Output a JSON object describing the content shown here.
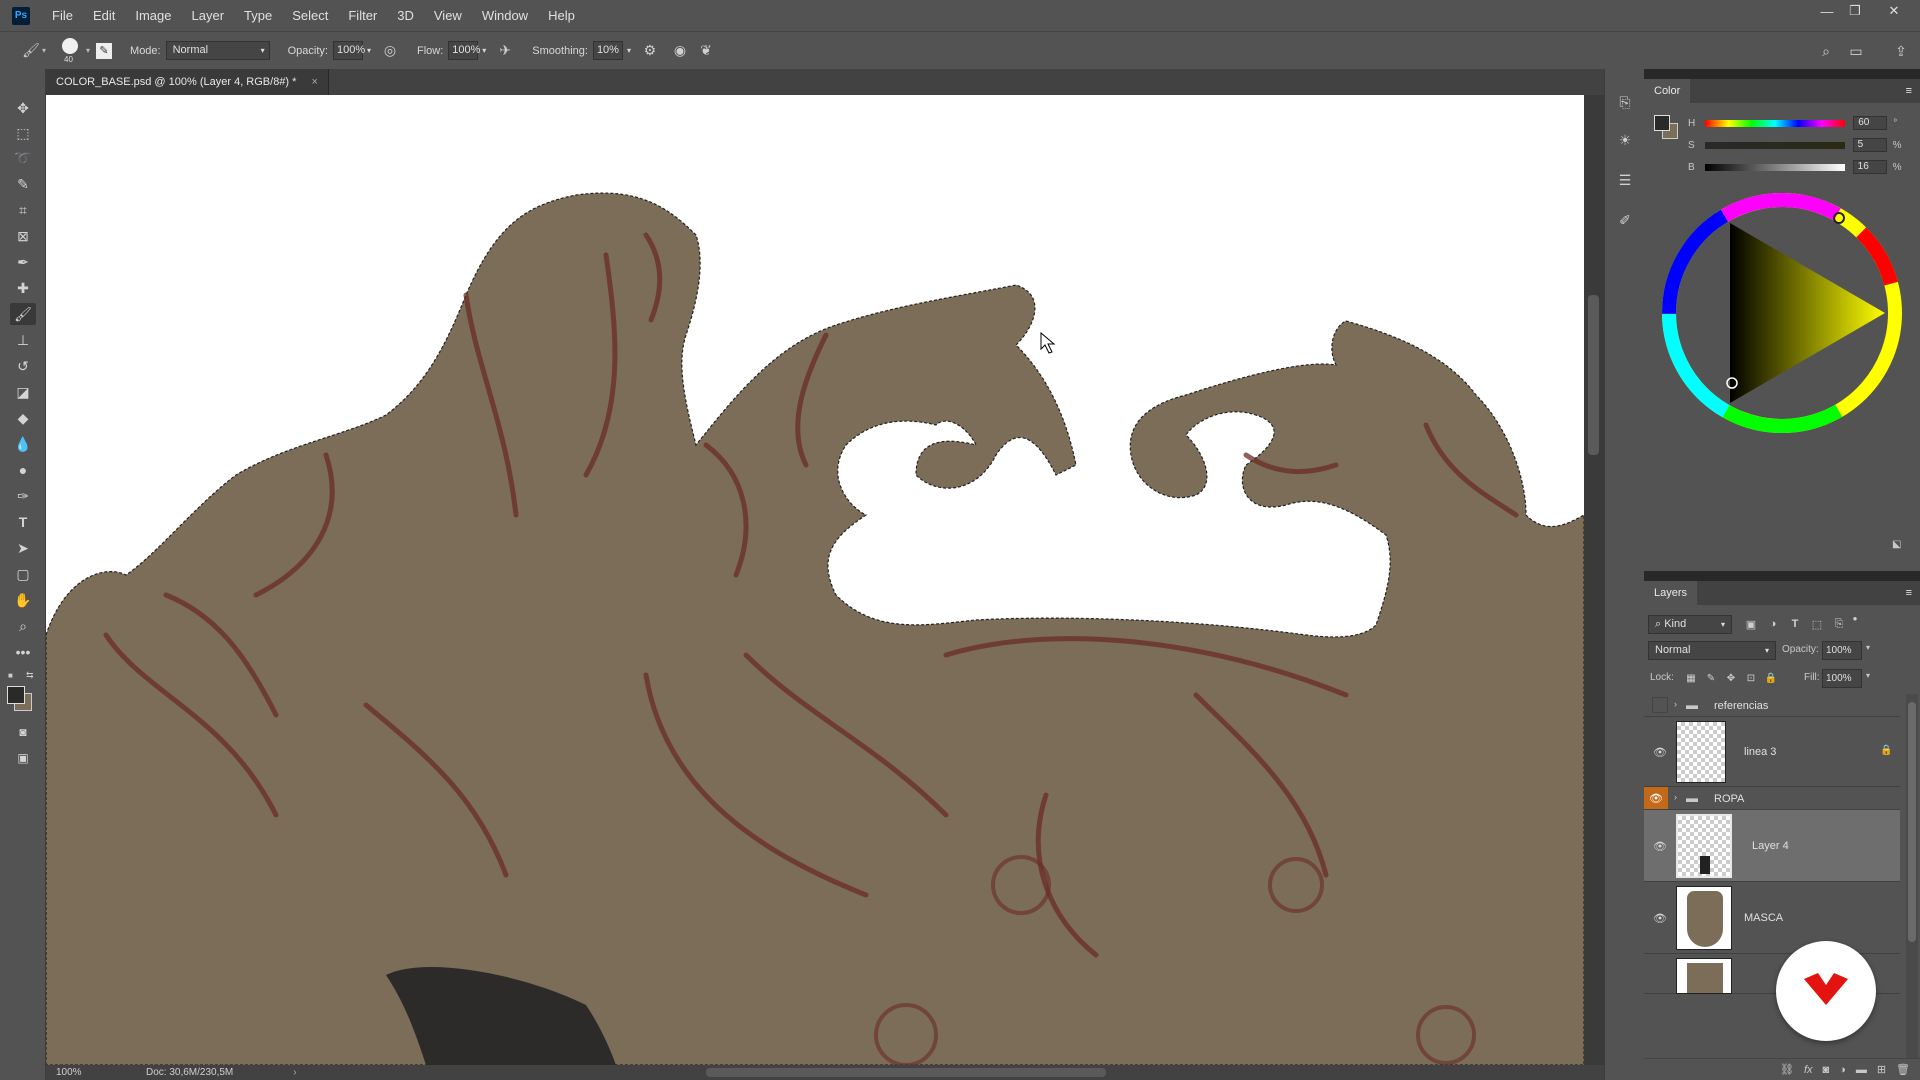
{
  "app": {
    "logo": "Ps"
  },
  "menu": [
    "File",
    "Edit",
    "Image",
    "Layer",
    "Type",
    "Select",
    "Filter",
    "3D",
    "View",
    "Window",
    "Help"
  ],
  "options": {
    "brush_size": "40",
    "mode_label": "Mode:",
    "mode_value": "Normal",
    "opacity_label": "Opacity:",
    "opacity_value": "100%",
    "flow_label": "Flow:",
    "flow_value": "100%",
    "smoothing_label": "Smoothing:",
    "smoothing_value": "10%"
  },
  "document": {
    "tab_title": "COLOR_BASE.psd @ 100% (Layer 4, RGB/8#) *",
    "close_glyph": "×"
  },
  "status": {
    "zoom": "100%",
    "doc_size": "Doc: 30,6M/230,5M"
  },
  "color_panel": {
    "title": "Color",
    "h_label": "H",
    "h_value": "60",
    "h_unit": "°",
    "s_label": "S",
    "s_value": "5",
    "s_unit": "%",
    "b_label": "B",
    "b_value": "16",
    "b_unit": "%",
    "foreground": "#2a2a28",
    "background": "#7b6d57"
  },
  "layers_panel": {
    "title": "Layers",
    "filter_kind": "Kind",
    "blend_mode": "Normal",
    "opacity_label": "Opacity:",
    "opacity_value": "100%",
    "lock_label": "Lock:",
    "fill_label": "Fill:",
    "fill_value": "100%",
    "layers": [
      {
        "name": "referencias",
        "type": "group"
      },
      {
        "name": "linea 3",
        "type": "layer"
      },
      {
        "name": "ROPA",
        "type": "group"
      },
      {
        "name": "Layer 4",
        "type": "layer"
      },
      {
        "name": "MASCA",
        "type": "layer"
      }
    ]
  },
  "colors": {
    "ui_bg": "#535353",
    "canvas_fill": "#7b6d57",
    "line": "#6b2c26",
    "accent_eye": "#c36a1a",
    "badge_red": "#e3140f"
  }
}
